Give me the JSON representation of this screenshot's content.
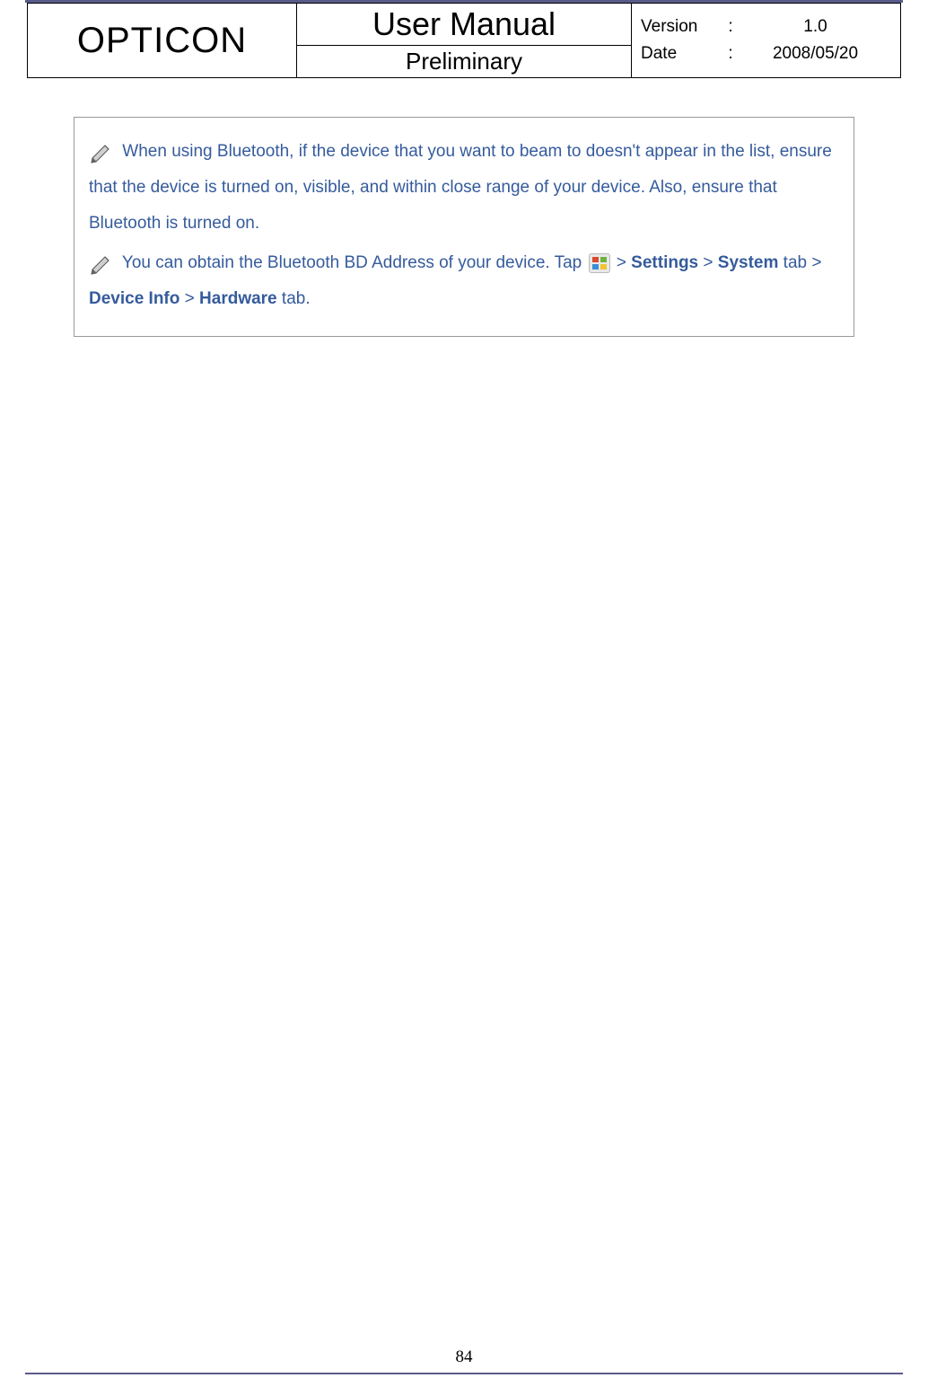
{
  "header": {
    "brand": "OPTICON",
    "title": "User Manual",
    "subtitle": "Preliminary",
    "meta": {
      "version_label": "Version",
      "version_value": "1.0",
      "date_label": "Date",
      "date_value": "2008/05/20",
      "colon": ":"
    }
  },
  "notes": {
    "note1_part1": " When using Bluetooth, if the device that you want to beam to doesn't appear in the list, ensure that the device is turned on, visible, and within close range of your device. Also, ensure that Bluetooth is turned on.",
    "note2_part1": " You can obtain the Bluetooth BD Address of your device. Tap ",
    "note2_gt1": " > ",
    "note2_settings": "Settings",
    "note2_gt2": " > ",
    "note2_system": "System",
    "note2_tab1": " tab > ",
    "note2_deviceinfo": "Device Info",
    "note2_gt3": " > ",
    "note2_hardware": "Hardware",
    "note2_tab2": " tab."
  },
  "page_number": "84"
}
